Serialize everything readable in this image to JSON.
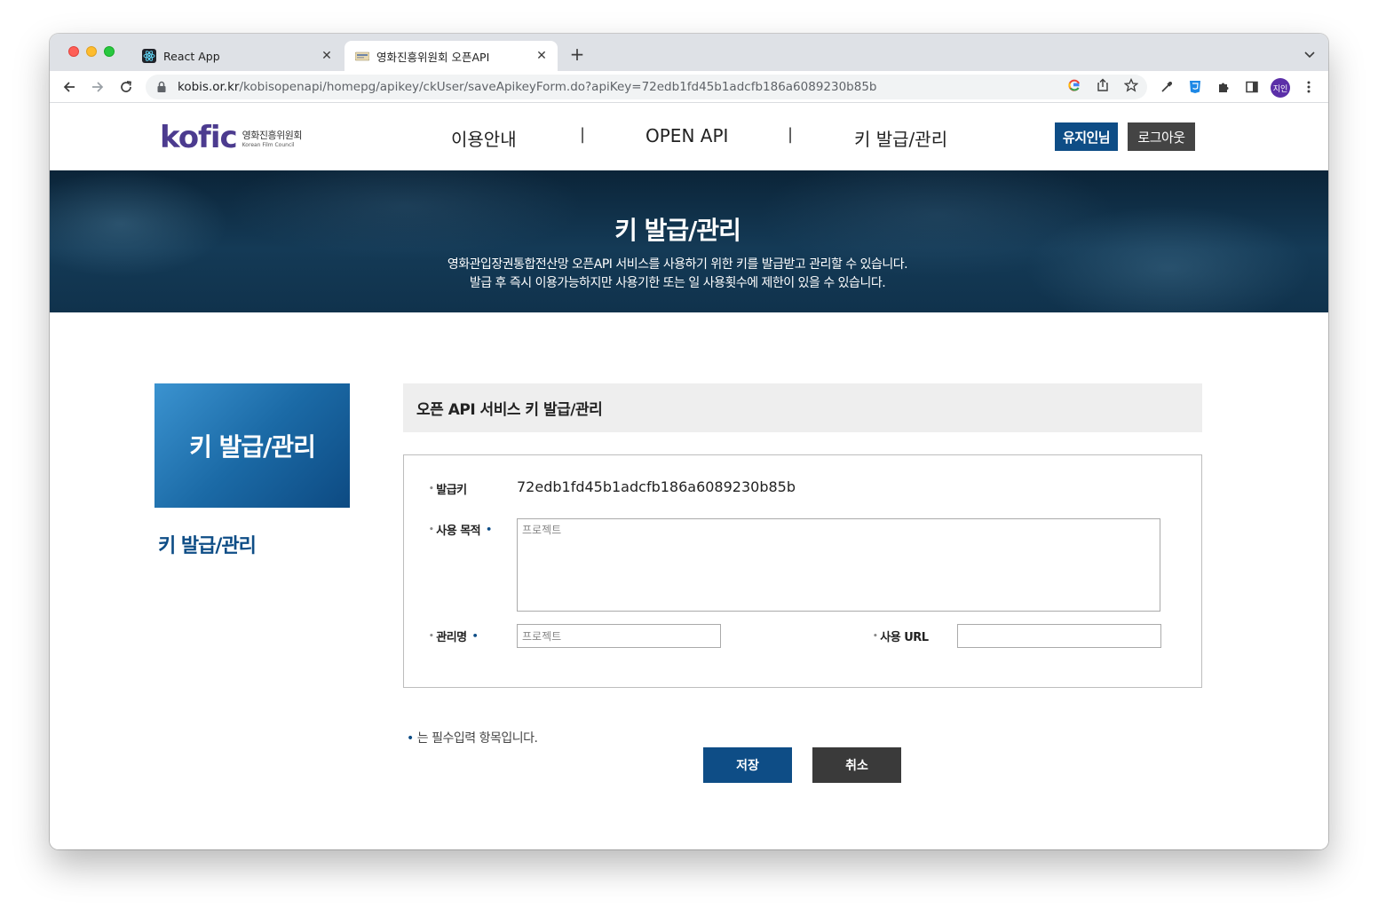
{
  "browser": {
    "tabs": [
      {
        "title": "React App"
      },
      {
        "title": "영화진흥위원회 오픈API"
      }
    ],
    "url_host": "kobis.or.kr",
    "url_path": "/kobisopenapi/homepg/apikey/ckUser/saveApikeyForm.do?apiKey=72edb1fd45b1adcfb186a6089230b85b",
    "profile_label": "지인"
  },
  "header": {
    "logo_word": "kofic",
    "logo_kr": "영화진흥위원회",
    "logo_en": "Korean Film Council",
    "nav": [
      "이용안내",
      "OPEN API",
      "키 발급/관리"
    ],
    "separator": "|",
    "user_button": "유지인님",
    "logout_button": "로그아웃"
  },
  "banner": {
    "title": "키 발급/관리",
    "desc_line1": "영화관입장권통합전산망 오픈API 서비스를 사용하기 위한 키를 발급받고 관리할 수 있습니다.",
    "desc_line2": "발급 후 즉시 이용가능하지만 사용기한 또는 일 사용횟수에 제한이 있을 수 있습니다."
  },
  "sidebar": {
    "box_title": "키 발급/관리",
    "link": "키 발급/관리"
  },
  "form": {
    "section_title": "오픈 API 서비스 키 발급/관리",
    "key_label": "발급키",
    "key_value": "72edb1fd45b1adcfb186a6089230b85b",
    "purpose_label": "사용 목적",
    "purpose_placeholder": "프로젝트",
    "name_label": "관리명",
    "name_placeholder": "프로젝트",
    "url_label": "사용 URL",
    "url_value": "",
    "required_marker": "•",
    "required_note": "는 필수입력 항목입니다.",
    "save_button": "저장",
    "cancel_button": "취소"
  },
  "colors": {
    "brand_blue": "#0e4d86",
    "logo_purple": "#4c3b8f",
    "banner_dark": "#0b2438"
  }
}
